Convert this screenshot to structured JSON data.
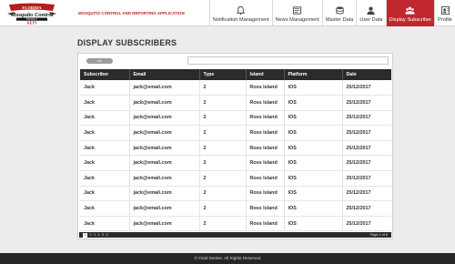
{
  "app": {
    "logo_text": "Florida Mosquito Control District KEYS",
    "title": "MOSQUITO CONTROL AND REPORTING APPLICATION"
  },
  "nav": [
    {
      "label": "Notification Management",
      "icon": "bell-icon",
      "active": false
    },
    {
      "label": "News Management",
      "icon": "newspaper-icon",
      "active": false
    },
    {
      "label": "Master Data",
      "icon": "database-icon",
      "active": false
    },
    {
      "label": "User Data",
      "icon": "user-icon",
      "active": false
    },
    {
      "label": "Display Subscriber",
      "icon": "users-icon",
      "active": true
    },
    {
      "label": "Profile",
      "icon": "profile-icon",
      "active": false
    }
  ],
  "page": {
    "title": "DISPLAY SUBSCRIBERS",
    "csv_label": "csv",
    "search_placeholder": ""
  },
  "table": {
    "headers": [
      "Subscriber",
      "Email",
      "Type",
      "Island",
      "Platform",
      "Date"
    ],
    "rows": [
      [
        "Jack",
        "jack@email.com",
        "2",
        "Ross Island",
        "IOS",
        "25/12/2017"
      ],
      [
        "Jack",
        "jack@email.com",
        "2",
        "Ross Island",
        "IOS",
        "25/12/2017"
      ],
      [
        "Jack",
        "jack@email.com",
        "2",
        "Ross Island",
        "IOS",
        "25/12/2017"
      ],
      [
        "Jack",
        "jack@email.com",
        "2",
        "Ross Island",
        "IOS",
        "25/12/2017"
      ],
      [
        "Jack",
        "jack@email.com",
        "2",
        "Ross Island",
        "IOS",
        "25/12/2017"
      ],
      [
        "Jack",
        "jack@email.com",
        "2",
        "Ross Island",
        "IOS",
        "25/12/2017"
      ],
      [
        "Jack",
        "jack@email.com",
        "2",
        "Ross Island",
        "IOS",
        "25/12/2017"
      ],
      [
        "Jack",
        "jack@email.com",
        "2",
        "Ross Island",
        "IOS",
        "25/12/2017"
      ],
      [
        "Jack",
        "jack@email.com",
        "2",
        "Ross Island",
        "IOS",
        "25/12/2017"
      ],
      [
        "Jack",
        "jack@email.com",
        "2",
        "Ross Island",
        "IOS",
        "25/12/2017"
      ]
    ]
  },
  "pagination": {
    "pages": [
      "1",
      "2",
      "3",
      "4",
      "5",
      "6"
    ],
    "current": "1",
    "page_count": "Page 1 of 6"
  },
  "footer": {
    "text": "© Field Seeker. All Rights Reserved"
  },
  "colors": {
    "accent": "#c0272d",
    "header_dark": "#2b2b2b",
    "footer": "#262626"
  }
}
